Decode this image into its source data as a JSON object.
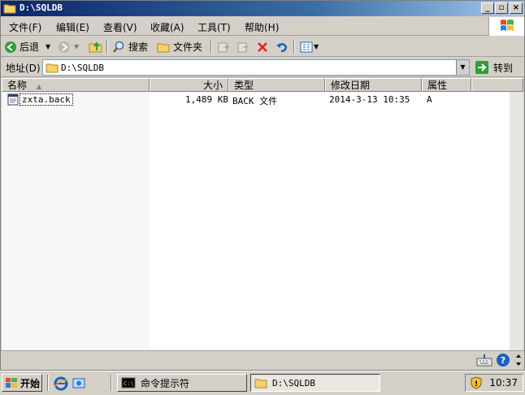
{
  "window": {
    "title": "D:\\SQLDB"
  },
  "menu": [
    {
      "label": "文件(F)"
    },
    {
      "label": "编辑(E)"
    },
    {
      "label": "查看(V)"
    },
    {
      "label": "收藏(A)"
    },
    {
      "label": "工具(T)"
    },
    {
      "label": "帮助(H)"
    }
  ],
  "toolbar": {
    "back_label": "后退",
    "search_label": "搜索",
    "folders_label": "文件夹"
  },
  "address": {
    "label": "地址(D)",
    "value": "D:\\SQLDB",
    "go_label": "转到"
  },
  "columns": [
    {
      "label": "名称"
    },
    {
      "label": "大小"
    },
    {
      "label": "类型"
    },
    {
      "label": "修改日期"
    },
    {
      "label": "属性"
    }
  ],
  "files": [
    {
      "name": "zxta.back",
      "size": "1,489 KB",
      "type": "BACK 文件",
      "modified": "2014-3-13 10:35",
      "attributes": "A"
    }
  ],
  "taskbar": {
    "start_label": "开始",
    "tasks": [
      {
        "label": "命令提示符"
      },
      {
        "label": "D:\\SQLDB"
      }
    ],
    "clock": "10:37"
  },
  "colors": {
    "titlebar_start": "#0a246a",
    "titlebar_end": "#a6caf0",
    "chrome": "#d4d0c8"
  }
}
